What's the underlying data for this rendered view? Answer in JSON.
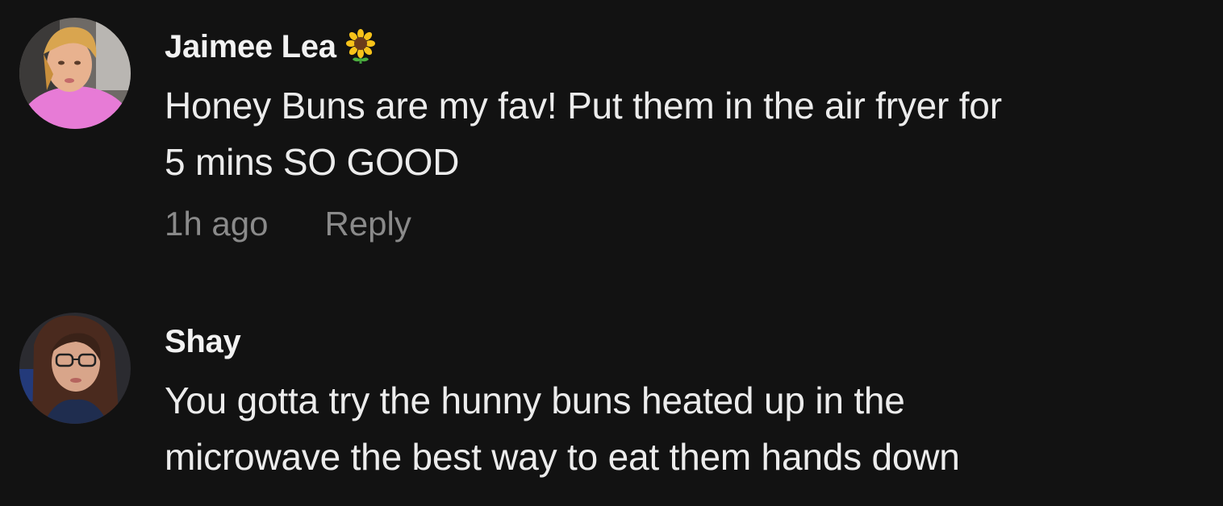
{
  "comments": [
    {
      "username": "Jaimee Lea",
      "username_emoji": "sunflower-icon",
      "text": "Honey Buns are my fav! Put them in the air fryer for\n5 mins SO GOOD",
      "time": "1h ago",
      "reply_label": "Reply"
    },
    {
      "username": "Shay",
      "text": "You gotta try the hunny buns heated up in the\nmicrowave the best way to eat them hands down"
    }
  ],
  "colors": {
    "background": "#121212",
    "username": "#f2f2f2",
    "text": "#ececec",
    "meta": "#8a8a8a"
  }
}
